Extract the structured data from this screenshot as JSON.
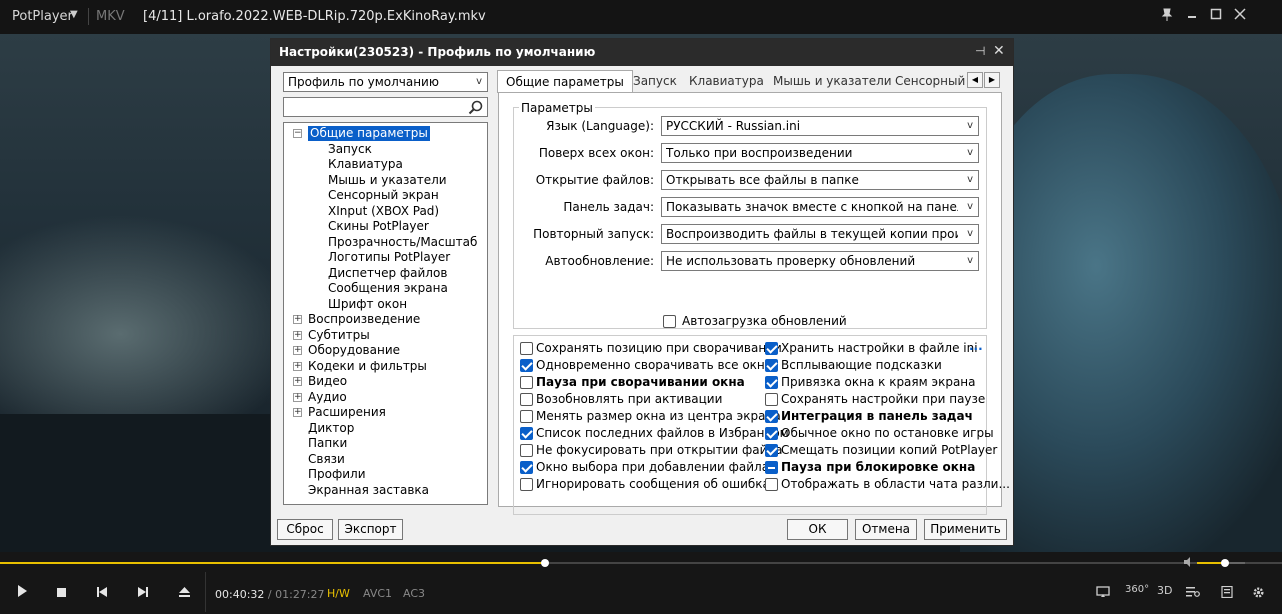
{
  "window": {
    "app_name": "PotPlayer",
    "format": "MKV",
    "file_title": "[4/11] L.orafo.2022.WEB-DLRip.720p.ExKinoRay.mkv",
    "icons": [
      "chevron-down-icon",
      "pin-icon",
      "restore-icon",
      "maximize-icon",
      "close-icon"
    ]
  },
  "dialog": {
    "title": "Настройки(230523) - Профиль по умолчанию",
    "profile": "Профиль по умолчанию",
    "search": {
      "placeholder": ""
    },
    "tree": [
      {
        "label": "Общие параметры",
        "level": 0,
        "expander": "−",
        "selected": true
      },
      {
        "label": "Запуск",
        "level": 1
      },
      {
        "label": "Клавиатура",
        "level": 1
      },
      {
        "label": "Мышь и указатели",
        "level": 1
      },
      {
        "label": "Сенсорный экран",
        "level": 1
      },
      {
        "label": "XInput (XBOX Pad)",
        "level": 1
      },
      {
        "label": "Скины PotPlayer",
        "level": 1
      },
      {
        "label": "Прозрачность/Масштаб",
        "level": 1
      },
      {
        "label": "Логотипы PotPlayer",
        "level": 1
      },
      {
        "label": "Диспетчер файлов",
        "level": 1
      },
      {
        "label": "Сообщения экрана",
        "level": 1
      },
      {
        "label": "Шрифт окон",
        "level": 1
      },
      {
        "label": "Воспроизведение",
        "level": 0,
        "expander": "+"
      },
      {
        "label": "Субтитры",
        "level": 0,
        "expander": "+"
      },
      {
        "label": "Оборудование",
        "level": 0,
        "expander": "+"
      },
      {
        "label": "Кодеки и фильтры",
        "level": 0,
        "expander": "+"
      },
      {
        "label": "Видео",
        "level": 0,
        "expander": "+"
      },
      {
        "label": "Аудио",
        "level": 0,
        "expander": "+"
      },
      {
        "label": "Расширения",
        "level": 0,
        "expander": "+"
      },
      {
        "label": "Диктор",
        "level": 0
      },
      {
        "label": "Папки",
        "level": 0
      },
      {
        "label": "Связи",
        "level": 0
      },
      {
        "label": "Профили",
        "level": 0
      },
      {
        "label": "Экранная заставка",
        "level": 0
      }
    ],
    "tabs": [
      "Общие параметры",
      "Запуск",
      "Клавиатура",
      "Мышь и указатели",
      "Сенсорный э"
    ],
    "group_title": "Параметры",
    "fields": [
      {
        "label": "Язык (Language):",
        "value": "РУССКИЙ - Russian.ini"
      },
      {
        "label": "Поверх всех окон:",
        "value": "Только при воспроизведении"
      },
      {
        "label": "Открытие файлов:",
        "value": "Открывать все файлы в папке"
      },
      {
        "label": "Панель задач:",
        "value": "Показывать значок вместе с кнопкой на панели задач"
      },
      {
        "label": "Повторный запуск:",
        "value": "Воспроизводить файлы в текущей копии проигрывателя"
      },
      {
        "label": "Автообновление:",
        "value": "Не использовать проверку обновлений"
      }
    ],
    "auto_download": {
      "label": "Автозагрузка обновлений",
      "state": "off"
    },
    "checks_left": [
      {
        "label": "Сохранять позицию при сворачивании",
        "state": "off",
        "bold": false
      },
      {
        "label": "Одновременно сворачивать все окна",
        "state": "on",
        "bold": false
      },
      {
        "label": "Пауза при сворачивании окна",
        "state": "off",
        "bold": true
      },
      {
        "label": "Возобновлять при активации",
        "state": "off",
        "bold": false
      },
      {
        "label": "Менять размер окна из центра экрана",
        "state": "off",
        "bold": false
      },
      {
        "label": "Список последних файлов в Избранном",
        "state": "on",
        "bold": false
      },
      {
        "label": "Не фокусировать при открытии файла",
        "state": "off",
        "bold": false
      },
      {
        "label": "Окно выбора при добавлении файла",
        "state": "on",
        "bold": false
      },
      {
        "label": "Игнорировать сообщения об ошибках",
        "state": "off",
        "bold": false
      }
    ],
    "checks_right": [
      {
        "label": "Хранить настройки в файле ini",
        "state": "on",
        "bold": false
      },
      {
        "label": "Всплывающие подсказки",
        "state": "on",
        "bold": false
      },
      {
        "label": "Привязка окна к краям экрана",
        "state": "on",
        "bold": false
      },
      {
        "label": "Сохранять настройки при паузе",
        "state": "off",
        "bold": false
      },
      {
        "label": "Интеграция в панель задач",
        "state": "on",
        "bold": true
      },
      {
        "label": "Обычное окно по остановке игры",
        "state": "on",
        "bold": false
      },
      {
        "label": "Смещать позиции копий PotPlayer",
        "state": "on",
        "bold": false
      },
      {
        "label": "Пауза при блокировке окна",
        "state": "ind",
        "bold": true
      },
      {
        "label": "Отображать в области чата разли...",
        "state": "off",
        "bold": false
      }
    ],
    "ini_more": "...",
    "buttons": {
      "reset": "Сброс",
      "export": "Экспорт",
      "ok": "ОК",
      "cancel": "Отмена",
      "apply": "Применить"
    }
  },
  "player": {
    "time_current": "00:40:32",
    "time_sep": " / ",
    "time_total": "01:27:27",
    "hw": "H/W",
    "video_codec": "AVC1",
    "audio_codec": "AC3",
    "seek_progress": 0.425,
    "volume_level": 0.58,
    "accent_color": "#e8c000",
    "icons": [
      "play-icon",
      "stop-icon",
      "prev-icon",
      "next-icon",
      "eject-icon",
      "volume-icon",
      "cast-icon",
      "vr-360-icon",
      "3d-icon",
      "playlist-icon",
      "chapter-icon",
      "menu-icon",
      "settings-icon"
    ]
  }
}
